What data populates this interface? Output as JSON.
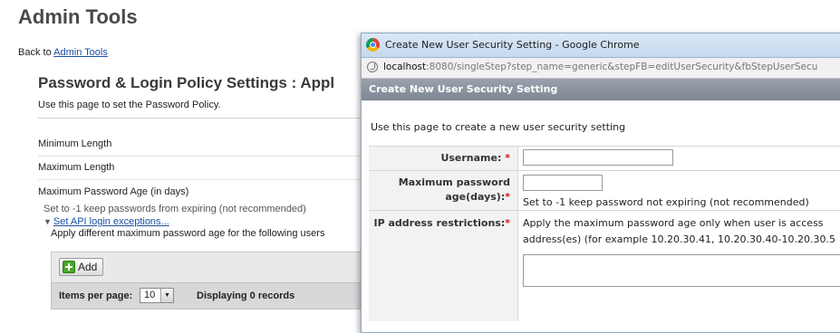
{
  "admin": {
    "title": "Admin Tools",
    "back_prefix": "Back to ",
    "back_link": "Admin Tools",
    "section_title": "Password & Login Policy Settings : Appl",
    "description": "Use this page to set the Password Policy.",
    "settings": [
      "Minimum Length",
      "Maximum Length",
      "Maximum Password Age (in days)"
    ],
    "age_note": "Set to -1 keep passwords from expiring (not recommended)",
    "exceptions_link": "Set API login exceptions...",
    "users_note": "Apply different maximum password age for the following users",
    "add_label": "Add",
    "pager": {
      "label": "Items per page:",
      "value": "10",
      "count": "Displaying 0 records"
    }
  },
  "popup": {
    "window_title": "Create New User Security Setting - Google Chrome",
    "url_host": "localhost",
    "url_rest": ":8080/singleStep?step_name=generic&stepFB=editUserSecurity&fbStepUserSecu",
    "header": "Create New User Security Setting",
    "description": "Use this page to create a new user security setting",
    "fields": {
      "username_label": "Username:",
      "max_age_label_line1": "Maximum password",
      "max_age_label_line2": "age(days):",
      "max_age_hint": "Set to -1 keep password not expiring (not recommended)",
      "ip_label": "IP address restrictions:",
      "ip_hint_line1": "Apply the maximum password age only when user is access",
      "ip_hint_line2": "address(es) (for example 10.20.30.41, 10.20.30.40-10.20.30.5",
      "required_mark": "*",
      "username_value": "",
      "max_age_value": "",
      "ip_value": ""
    }
  },
  "colors": {
    "link": "#1a4fa3",
    "required": "#dd1111",
    "dialog_header": "#8a929d",
    "add_icon": "#4aa62b"
  },
  "icons": [
    "chrome-icon",
    "page-icon",
    "plus-icon",
    "triangle-down-icon",
    "dropdown-arrow-icon"
  ]
}
